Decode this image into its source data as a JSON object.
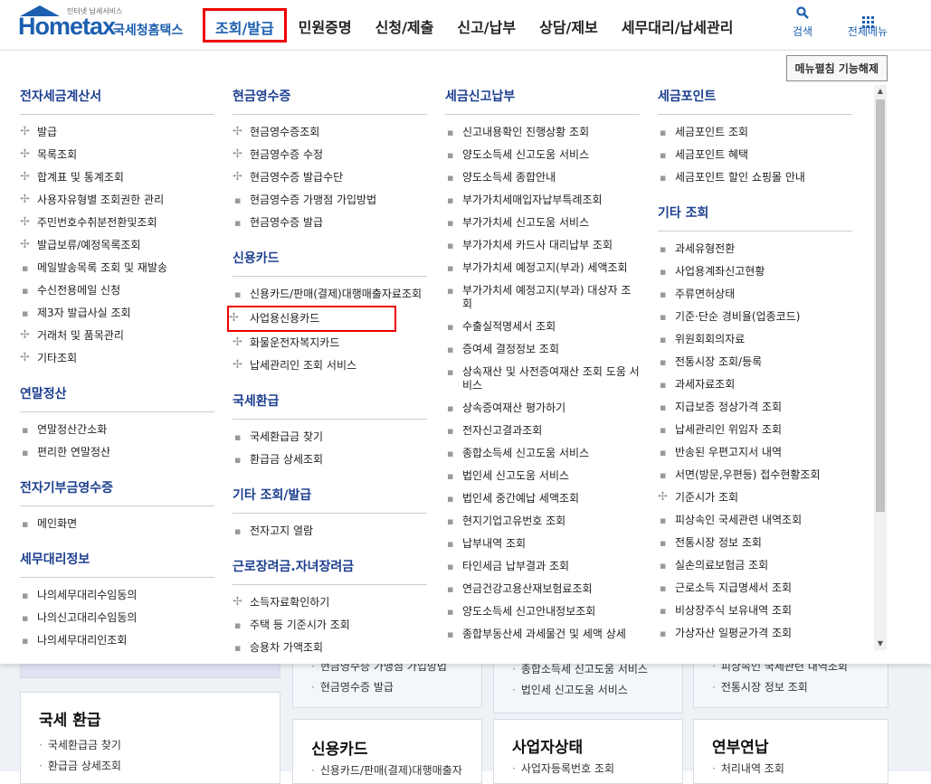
{
  "header": {
    "logo_home": "Hometax",
    "logo_tagline": "인터넷 납세서비스",
    "logo_brand": "국세청홈택스",
    "nav": [
      "조회/발급",
      "민원증명",
      "신청/제출",
      "신고/납부",
      "상담/제보",
      "세무대리/납세관리"
    ],
    "tools": {
      "search": "검색",
      "all_menu": "전체메뉴"
    }
  },
  "mega": {
    "unfix_button": "메뉴펼침 기능해제",
    "col1": [
      {
        "title": "전자세금계산서",
        "items": [
          {
            "t": "발급",
            "b": "plus"
          },
          {
            "t": "목록조회",
            "b": "plus"
          },
          {
            "t": "합계표 및 통계조회",
            "b": "plus"
          },
          {
            "t": "사용자유형별 조회권한 관리",
            "b": "plus"
          },
          {
            "t": "주민번호수취분전환및조회",
            "b": "plus"
          },
          {
            "t": "발급보류/예정목록조회",
            "b": "plus"
          },
          {
            "t": "메일발송목록 조회 및 재발송",
            "b": "dot"
          },
          {
            "t": "수신전용메일 신청",
            "b": "dot"
          },
          {
            "t": "제3자 발급사실 조회",
            "b": "dot"
          },
          {
            "t": "거래처 및 품목관리",
            "b": "plus"
          },
          {
            "t": "기타조회",
            "b": "plus"
          }
        ]
      },
      {
        "title": "연말정산",
        "items": [
          {
            "t": "연말정산간소화",
            "b": "dot"
          },
          {
            "t": "편리한 연말정산",
            "b": "dot"
          }
        ]
      },
      {
        "title": "전자기부금영수증",
        "items": [
          {
            "t": "메인화면",
            "b": "dot"
          }
        ]
      },
      {
        "title": "세무대리정보",
        "items": [
          {
            "t": "나의세무대리수임동의",
            "b": "dot"
          },
          {
            "t": "나의신고대리수임동의",
            "b": "dot"
          },
          {
            "t": "나의세무대리인조회",
            "b": "dot"
          }
        ]
      }
    ],
    "col2": [
      {
        "title": "현금영수증",
        "items": [
          {
            "t": "현금영수증조회",
            "b": "plus"
          },
          {
            "t": "현금영수증 수정",
            "b": "plus"
          },
          {
            "t": "현금영수증 발급수단",
            "b": "plus"
          },
          {
            "t": "현금영수증 가맹점 가입방법",
            "b": "dot"
          },
          {
            "t": "현금영수증 발급",
            "b": "dot"
          }
        ]
      },
      {
        "title": "신용카드",
        "items": [
          {
            "t": "신용카드/판매(결제)대행매출자료조회",
            "b": "dot"
          },
          {
            "t": "사업용신용카드",
            "b": "plus",
            "hl": true
          },
          {
            "t": "화물운전자복지카드",
            "b": "plus"
          },
          {
            "t": "납세관리인 조회 서비스",
            "b": "plus"
          }
        ]
      },
      {
        "title": "국세환급",
        "items": [
          {
            "t": "국세환급금 찾기",
            "b": "dot"
          },
          {
            "t": "환급금 상세조회",
            "b": "dot"
          }
        ]
      },
      {
        "title": "기타 조회/발급",
        "items": [
          {
            "t": "전자고지 열람",
            "b": "dot"
          }
        ]
      },
      {
        "title": "근로장려금.자녀장려금",
        "items": [
          {
            "t": "소득자료확인하기",
            "b": "plus"
          },
          {
            "t": "주택 등 기준시가 조회",
            "b": "dot"
          },
          {
            "t": "승용차 가액조회",
            "b": "dot"
          }
        ]
      }
    ],
    "col3": [
      {
        "title": "세금신고납부",
        "items": [
          {
            "t": "신고내용확인 진행상황 조회",
            "b": "dot"
          },
          {
            "t": "양도소득세 신고도움 서비스",
            "b": "dot"
          },
          {
            "t": "양도소득세 종합안내",
            "b": "dot"
          },
          {
            "t": "부가가치세매입자납부특례조회",
            "b": "dot"
          },
          {
            "t": "부가가치세 신고도움 서비스",
            "b": "dot"
          },
          {
            "t": "부가가치세 카드사 대리납부 조회",
            "b": "dot"
          },
          {
            "t": "부가가치세 예정고지(부과) 세액조회",
            "b": "dot"
          },
          {
            "t": "부가가치세 예정고지(부과) 대상자 조회",
            "b": "dot"
          },
          {
            "t": "수출실적명세서 조회",
            "b": "dot"
          },
          {
            "t": "증여세 결정정보 조회",
            "b": "dot"
          },
          {
            "t": "상속재산 및 사전증여재산 조회 도움 서비스",
            "b": "dot"
          },
          {
            "t": "상속증여재산 평가하기",
            "b": "dot"
          },
          {
            "t": "전자신고결과조회",
            "b": "dot"
          },
          {
            "t": "종합소득세 신고도움 서비스",
            "b": "dot"
          },
          {
            "t": "법인세 신고도움 서비스",
            "b": "dot"
          },
          {
            "t": "법인세 중간예납 세액조회",
            "b": "dot"
          },
          {
            "t": "현지기업고유번호 조회",
            "b": "dot"
          },
          {
            "t": "납부내역 조회",
            "b": "dot"
          },
          {
            "t": "타인세금 납부결과 조회",
            "b": "dot"
          },
          {
            "t": "연금건강고용산재보험료조회",
            "b": "dot"
          },
          {
            "t": "양도소득세 신고안내정보조회",
            "b": "dot"
          },
          {
            "t": "종합부동산세 과세물건 및 세액 상세",
            "b": "dot"
          }
        ]
      }
    ],
    "col4": [
      {
        "title": "세금포인트",
        "items": [
          {
            "t": "세금포인트 조회",
            "b": "dot"
          },
          {
            "t": "세금포인트 혜택",
            "b": "dot"
          },
          {
            "t": "세금포인트 할인 쇼핑몰 안내",
            "b": "dot"
          }
        ]
      },
      {
        "title": "기타 조회",
        "items": [
          {
            "t": "과세유형전환",
            "b": "dot"
          },
          {
            "t": "사업용계좌신고현황",
            "b": "dot"
          },
          {
            "t": "주류면허상태",
            "b": "dot"
          },
          {
            "t": "기준·단순 경비율(업종코드)",
            "b": "dot"
          },
          {
            "t": "위원회회의자료",
            "b": "dot"
          },
          {
            "t": "전통시장 조회/등록",
            "b": "dot"
          },
          {
            "t": "과세자료조회",
            "b": "dot"
          },
          {
            "t": "지급보증 정상가격 조회",
            "b": "dot"
          },
          {
            "t": "납세관리인 위임자 조회",
            "b": "dot"
          },
          {
            "t": "반송된 우편고지서 내역",
            "b": "dot"
          },
          {
            "t": "서면(방문,우편등) 접수현황조회",
            "b": "dot"
          },
          {
            "t": "기준시가 조회",
            "b": "plus"
          },
          {
            "t": "피상속인 국세관련 내역조회",
            "b": "dot"
          },
          {
            "t": "전통시장 정보 조회",
            "b": "dot"
          },
          {
            "t": "실손의료보험금 조회",
            "b": "dot"
          },
          {
            "t": "근로소득 지급명세서 조회",
            "b": "dot"
          },
          {
            "t": "비상장주식 보유내역 조회",
            "b": "dot"
          },
          {
            "t": "가상자산 일평균가격 조회",
            "b": "dot"
          }
        ]
      }
    ]
  },
  "background": {
    "card_a_items": [
      "현금영수증 가맹점 가입방법",
      "현금영수증 발급"
    ],
    "card_b_items": [
      "종합소득세 신고도움 서비스",
      "법인세 신고도움 서비스"
    ],
    "card_c_items": [
      "피상속인 국세관련 내역조회",
      "전통시장 정보 조회"
    ],
    "refund_title": "국세 환급",
    "refund_items": [
      "국세환급금 찾기",
      "환급금 상세조회"
    ],
    "card_titles": [
      "신용카드",
      "사업자상태",
      "연부연납"
    ],
    "credit_item": "신용카드/판매(결제)대행매출자",
    "biz_item": "사업자등록번호 조회",
    "pay_item": "처리내역 조회"
  }
}
